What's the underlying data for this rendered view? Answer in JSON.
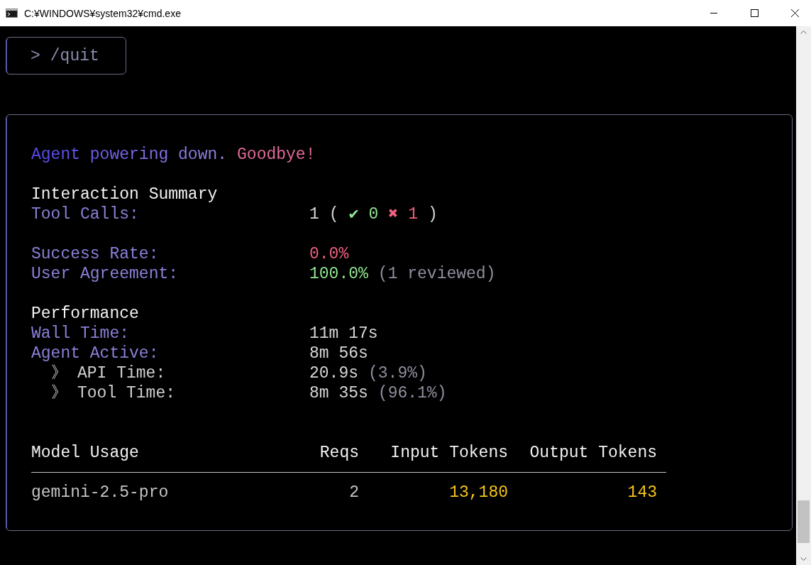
{
  "window": {
    "title": "C:¥WINDOWS¥system32¥cmd.exe"
  },
  "prompt": {
    "symbol": ">",
    "command": "/quit"
  },
  "farewell": {
    "message": "Agent powering down.",
    "goodbye": "Goodbye!"
  },
  "sections": [
    {
      "heading": "Interaction Summary",
      "groups": [
        [
          {
            "label": "Tool Calls:",
            "value": [
              {
                "text": "1",
                "kind": "plain"
              },
              {
                "text": "(",
                "kind": "plain"
              },
              {
                "text": "✔",
                "kind": "success"
              },
              {
                "text": "0",
                "kind": "success"
              },
              {
                "text": "✖",
                "kind": "failure"
              },
              {
                "text": "1",
                "kind": "failure"
              },
              {
                "text": ")",
                "kind": "plain"
              }
            ]
          }
        ],
        [
          {
            "label": "Success Rate:",
            "value": [
              {
                "text": "0.0%",
                "kind": "failure"
              }
            ]
          },
          {
            "label": "User Agreement:",
            "value": [
              {
                "text": "100.0%",
                "kind": "success"
              },
              {
                "text": "(1 reviewed)",
                "kind": "muted"
              }
            ]
          }
        ]
      ]
    },
    {
      "heading": "Performance",
      "groups": [
        [
          {
            "label": "Wall Time:",
            "value": [
              {
                "text": "11m 17s",
                "kind": "plain"
              }
            ]
          },
          {
            "label": "Agent Active:",
            "value": [
              {
                "text": "8m 56s",
                "kind": "plain"
              }
            ],
            "children": [
              {
                "marker": "》",
                "label": "API Time:",
                "value": [
                  {
                    "text": "20.9s",
                    "kind": "plain"
                  },
                  {
                    "text": "(3.9%)",
                    "kind": "muted"
                  }
                ]
              },
              {
                "marker": "》",
                "label": "Tool Time:",
                "value": [
                  {
                    "text": "8m 35s",
                    "kind": "plain"
                  },
                  {
                    "text": "(96.1%)",
                    "kind": "muted"
                  }
                ]
              }
            ]
          }
        ]
      ]
    }
  ],
  "table": {
    "columns": [
      "Model Usage",
      "Reqs",
      "Input Tokens",
      "Output Tokens"
    ],
    "rows": [
      {
        "model": "gemini-2.5-pro",
        "reqs": "2",
        "input_tokens": "13,180",
        "output_tokens": "143"
      }
    ]
  }
}
